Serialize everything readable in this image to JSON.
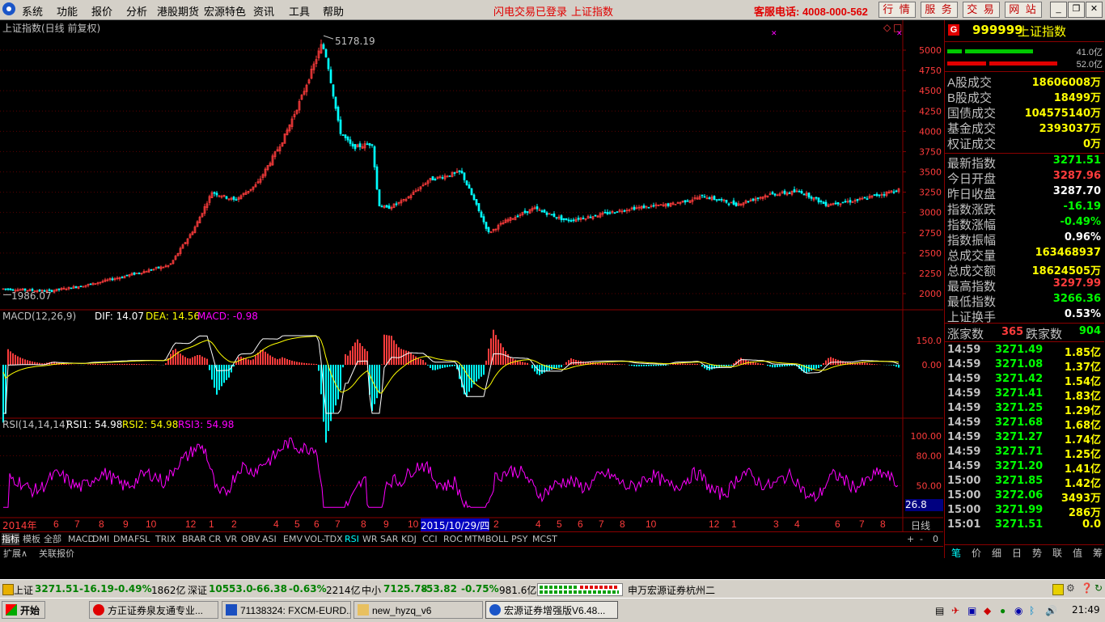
{
  "menu": [
    "系统",
    "功能",
    "报价",
    "分析",
    "港股期货",
    "宏源特色",
    "资讯",
    "工具",
    "帮助"
  ],
  "login_status": "闪电交易已登录",
  "index_link": "上证指数",
  "hotline": "客服电话: 4008-000-562",
  "top_buttons": [
    "行 情",
    "服 务",
    "交 易",
    "网 站"
  ],
  "window_buttons": [
    "_",
    "❐",
    "✕"
  ],
  "chart": {
    "title": "上证指数(日线 前复权)",
    "high_label": "5178.19",
    "low_label": "1986.07",
    "y_ticks": [
      "5000",
      "4750",
      "4500",
      "4250",
      "4000",
      "3750",
      "3500",
      "3250",
      "3000",
      "2750",
      "2500",
      "2250",
      "2000"
    ],
    "x_year": "2014年",
    "x_labels": [
      "6",
      "7",
      "8",
      "9",
      "10",
      "12",
      "1",
      "2",
      "4",
      "5",
      "6",
      "7",
      "8",
      "9",
      "10",
      "2",
      "4",
      "5",
      "6",
      "7",
      "8",
      "10",
      "12",
      "1",
      "3",
      "4",
      "6",
      "7",
      "8"
    ],
    "cursor_date": "2015/10/29/四",
    "period": "日线"
  },
  "macd": {
    "title": "MACD(12,26,9)",
    "dif": "DIF: 14.07",
    "dea": "DEA: 14.56",
    "macd": "MACD: -0.98",
    "y_ticks": [
      "150.0",
      "0.00"
    ]
  },
  "rsi": {
    "title": "RSI(14,14,14)",
    "rsi1": "RSI1: 54.98",
    "rsi2": "RSI2: 54.98",
    "rsi3": "RSI3: 54.98",
    "y_ticks": [
      "100.00",
      "80.00",
      "50.00"
    ],
    "cursor_value": "26.8"
  },
  "indicator_tabs": [
    "指标",
    "模板",
    "全部",
    "MACD",
    "DMI",
    "DMA",
    "FSL",
    "TRIX",
    "BRAR",
    "CR",
    "VR",
    "OBV",
    "ASI",
    "EMV",
    "VOL-TDX",
    "RSI",
    "WR",
    "SAR",
    "KDJ",
    "CCI",
    "ROC",
    "MTM",
    "BOLL",
    "PSY",
    "MCST"
  ],
  "zoom_controls": [
    "+",
    "-",
    "0"
  ],
  "extra_tabs": [
    "扩展∧",
    "关联报价"
  ],
  "quote": {
    "badge": "G",
    "code": "999999",
    "name": "上证指数",
    "buy_amount": "41.0亿",
    "sell_amount": "52.0亿",
    "volume_rows": [
      {
        "k": "A股成交",
        "v": "18606008万"
      },
      {
        "k": "B股成交",
        "v": "18499万"
      },
      {
        "k": "国债成交",
        "v": "104575140万"
      },
      {
        "k": "基金成交",
        "v": "2393037万"
      },
      {
        "k": "权证成交",
        "v": "0万"
      }
    ],
    "index_rows": [
      {
        "k": "最新指数",
        "v": "3271.51",
        "c": "#00ff00"
      },
      {
        "k": "今日开盘",
        "v": "3287.96",
        "c": "#ff3c3c"
      },
      {
        "k": "昨日收盘",
        "v": "3287.70",
        "c": "#ffffff"
      },
      {
        "k": "指数涨跌",
        "v": "-16.19",
        "c": "#00ff00"
      },
      {
        "k": "指数涨幅",
        "v": "-0.49%",
        "c": "#00ff00"
      },
      {
        "k": "指数振幅",
        "v": "0.96%",
        "c": "#ffffff"
      },
      {
        "k": "总成交量",
        "v": "163468937",
        "c": "#ffff00"
      },
      {
        "k": "总成交额",
        "v": "18624505万",
        "c": "#ffff00"
      },
      {
        "k": "最高指数",
        "v": "3297.99",
        "c": "#ff3c3c"
      },
      {
        "k": "最低指数",
        "v": "3266.36",
        "c": "#00ff00"
      },
      {
        "k": "上证换手",
        "v": "0.53%",
        "c": "#ffffff"
      }
    ],
    "up_label": "涨家数",
    "up_count": "365",
    "down_label": "跌家数",
    "down_count": "904",
    "ticks": [
      {
        "t": "14:59",
        "p": "3271.49",
        "a": "1.85亿"
      },
      {
        "t": "14:59",
        "p": "3271.08",
        "a": "1.37亿"
      },
      {
        "t": "14:59",
        "p": "3271.42",
        "a": "1.54亿"
      },
      {
        "t": "14:59",
        "p": "3271.41",
        "a": "1.83亿"
      },
      {
        "t": "14:59",
        "p": "3271.25",
        "a": "1.29亿"
      },
      {
        "t": "14:59",
        "p": "3271.68",
        "a": "1.68亿"
      },
      {
        "t": "14:59",
        "p": "3271.27",
        "a": "1.74亿"
      },
      {
        "t": "14:59",
        "p": "3271.71",
        "a": "1.25亿"
      },
      {
        "t": "14:59",
        "p": "3271.20",
        "a": "1.41亿"
      },
      {
        "t": "15:00",
        "p": "3271.85",
        "a": "1.42亿"
      },
      {
        "t": "15:00",
        "p": "3272.06",
        "a": "3493万"
      },
      {
        "t": "15:00",
        "p": "3271.99",
        "a": "286万"
      },
      {
        "t": "15:01",
        "p": "3271.51",
        "a": "0.0"
      }
    ],
    "bottom_tabs": [
      "笔",
      "价",
      "细",
      "日",
      "势",
      "联",
      "值",
      "筹"
    ]
  },
  "status": {
    "sh_name": "上证",
    "sh_price": "3271.51",
    "sh_change": "-16.19",
    "sh_pct": "-0.49%",
    "sh_amt": "1862亿",
    "sz_name": "深证",
    "sz_price": "10553.0",
    "sz_change": "-66.38",
    "sz_pct": "-0.63%",
    "sz_amt": "2214亿",
    "zx_name": "中小",
    "zx_price": "7125.78",
    "zx_change": "-53.82",
    "zx_pct": "-0.75%",
    "zx_amt": "981.6亿",
    "broker": "申万宏源证券杭州二"
  },
  "taskbar": {
    "start": "开始",
    "tasks": [
      "方正证券泉友通专业...",
      "71138324: FXCM-EURD...",
      "new_hyzq_v6",
      "宏源证券增强版V6.48..."
    ],
    "clock": "21:49"
  },
  "colors": {
    "up": "#ff3c3c",
    "down": "#00ffff",
    "macd_dif": "#ffffff",
    "macd_dea": "#ffff00",
    "rsi": "#ff00ff",
    "axis": "#8b0000"
  }
}
